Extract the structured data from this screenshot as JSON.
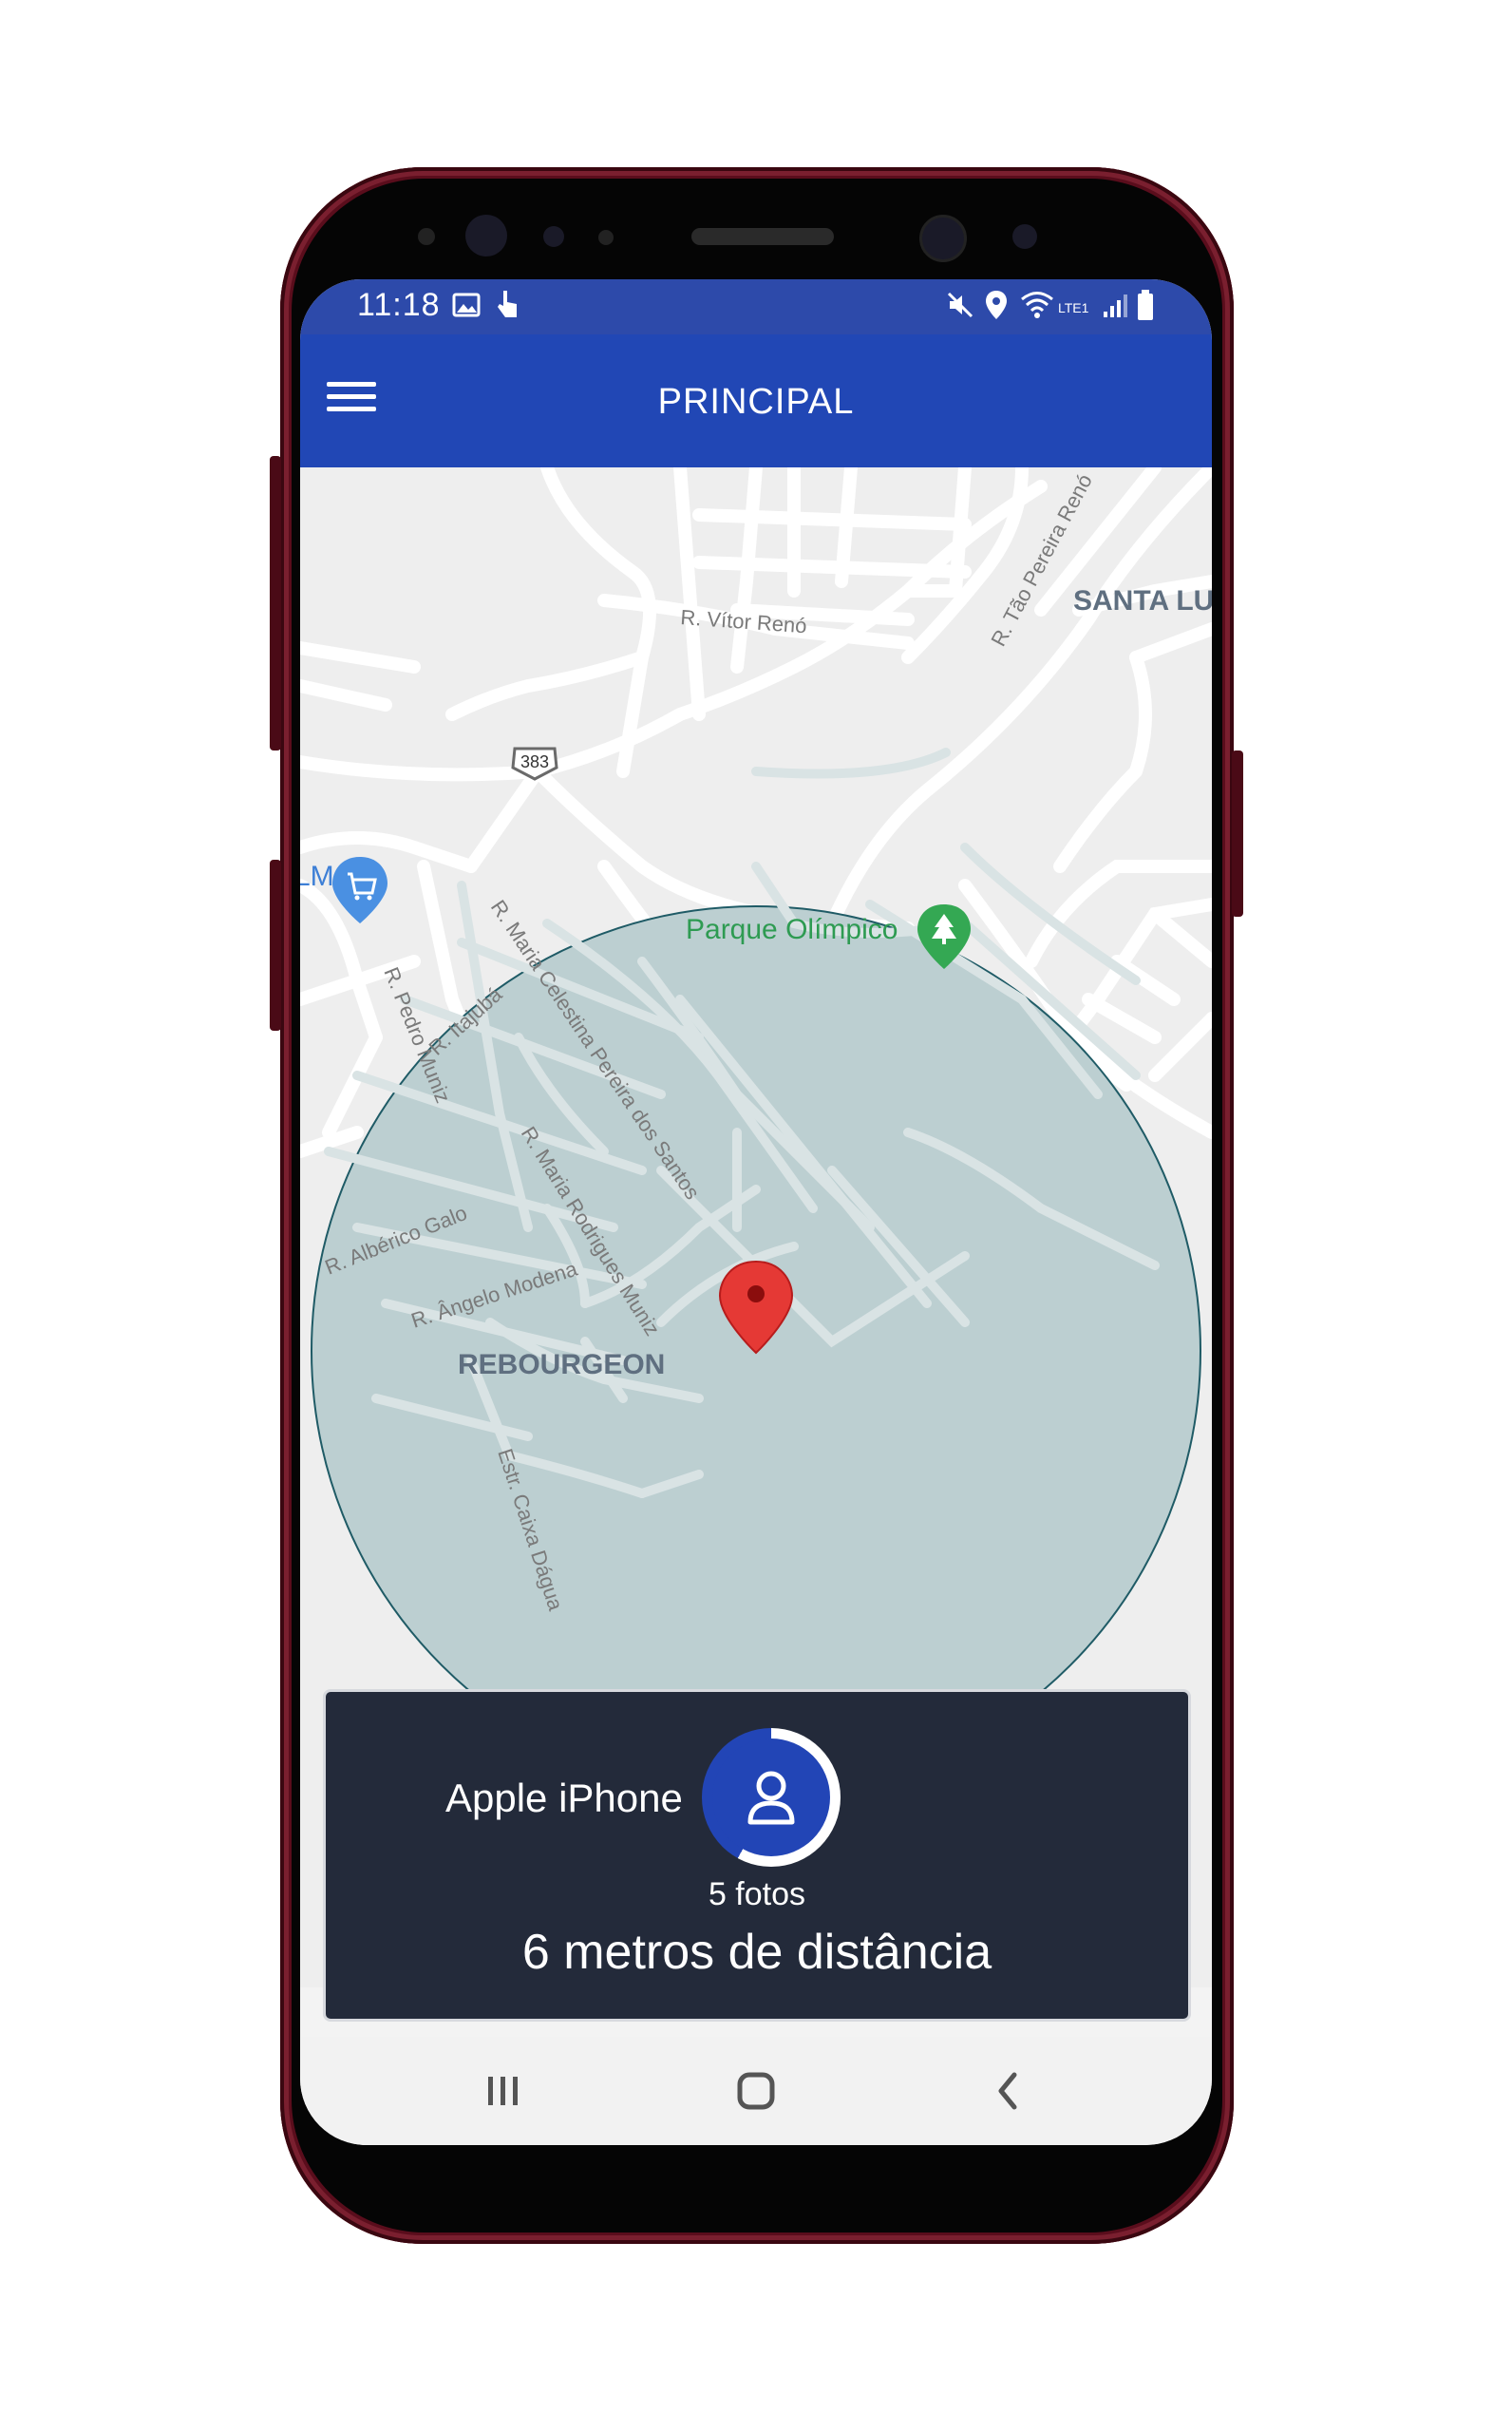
{
  "status_bar": {
    "time": "11:18",
    "network_label": "LTE1"
  },
  "app_bar": {
    "title": "PRINCIPAL",
    "menu_icon": "hamburger-menu-icon"
  },
  "map": {
    "place_labels": {
      "santa_lucia": "SANTA LU",
      "lm": "LM",
      "rebourgeon": "REBOURGEON",
      "parque": "Parque Olímpico"
    },
    "street_labels": {
      "vitor_reno": "R. Vítor Renó",
      "tao_pereira": "R. Tão Pereira Renó",
      "celestina": "R. Maria Celestina Pereira dos Santos",
      "itajuba": "R. Itajubá",
      "pedro_muniz": "R. Pedro Muniz",
      "rodrigues": "R. Maria Rodrigues Muniz",
      "alberico": "R. Albérico Galo",
      "angelo": "R. Ângelo Modena",
      "caixa": "Estr. Caixa Dágua"
    },
    "route_shield": "383",
    "circle_color": "#bccfd1",
    "pin_color": "#e53935"
  },
  "device_card": {
    "device_name": "Apple iPhone",
    "photos": "5 fotos",
    "distance": "6 metros de distância",
    "progress_fraction": 0.58
  },
  "colors": {
    "appbar": "#2147b5",
    "card": "#232a3a",
    "accent": "#2245b6"
  }
}
